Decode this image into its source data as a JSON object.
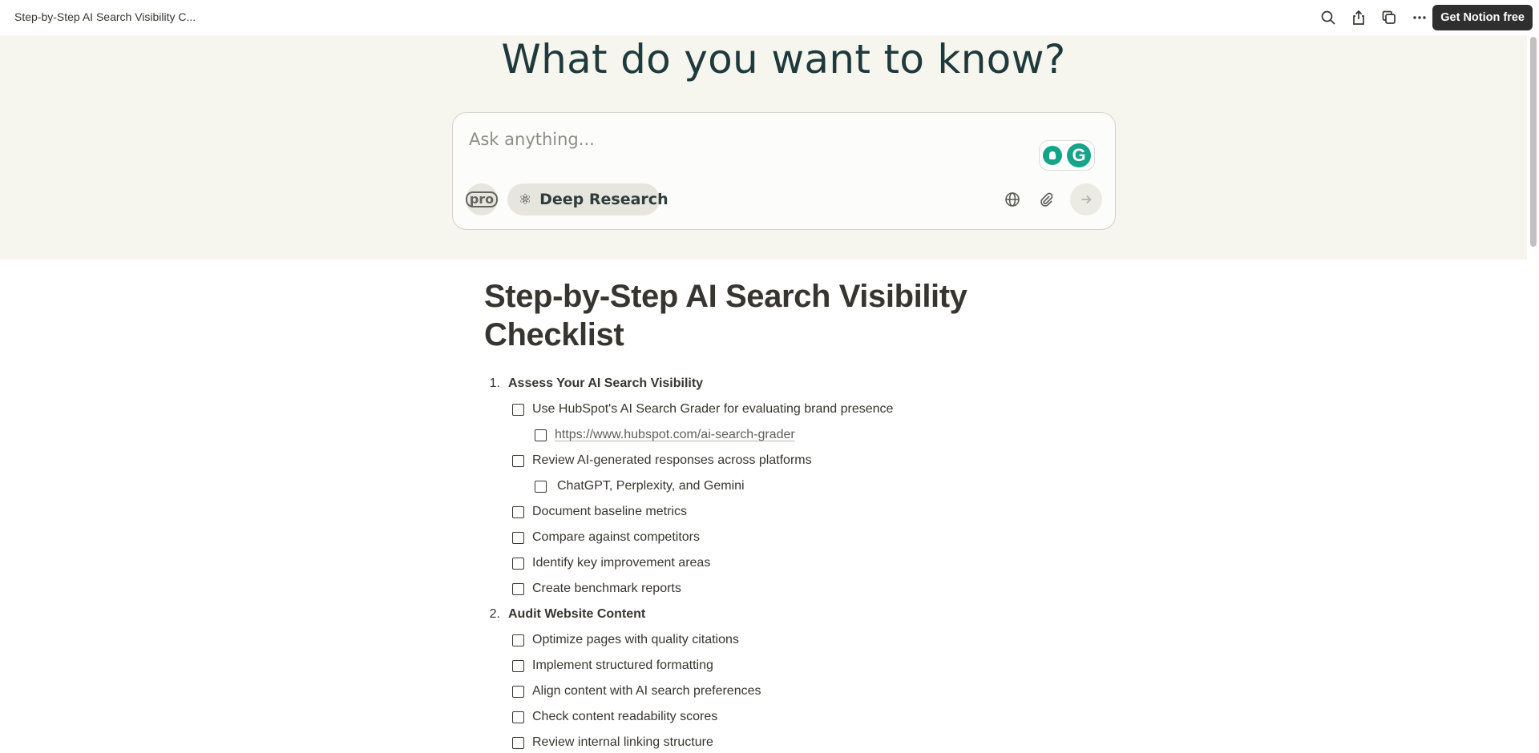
{
  "topbar": {
    "page_title": "Step-by-Step AI Search Visibility C...",
    "cta_label": "Get Notion free",
    "icons": [
      "search-icon",
      "share-icon",
      "duplicate-icon",
      "more-icon"
    ]
  },
  "search_embed": {
    "headline": "What do you want to know?",
    "placeholder": "Ask anything...",
    "pro_label": "pro",
    "deep_research_label": "Deep Research",
    "icons": [
      "grammarly-bulb-icon",
      "grammarly-logo-icon",
      "atom-icon",
      "globe-icon",
      "paperclip-icon",
      "arrow-right-icon"
    ]
  },
  "doc": {
    "title": "Step-by-Step AI Search Visibility Checklist",
    "sections": [
      {
        "number": "1.",
        "title": "Assess Your AI Search Visibility",
        "items": [
          {
            "text": "Use HubSpot's AI Search Grader for evaluating brand presence",
            "subitems": [
              {
                "text": "https://www.hubspot.com/ai-search-grader",
                "link": true
              }
            ]
          },
          {
            "text": "Review AI-generated responses across platforms",
            "subitems": [
              {
                "text": "ChatGPT, Perplexity, and Gemini"
              }
            ]
          },
          {
            "text": "Document baseline metrics"
          },
          {
            "text": "Compare against competitors"
          },
          {
            "text": "Identify key improvement areas"
          },
          {
            "text": "Create benchmark reports"
          }
        ]
      },
      {
        "number": "2.",
        "title": "Audit Website Content",
        "items": [
          {
            "text": "Optimize pages with quality citations"
          },
          {
            "text": "Implement structured formatting"
          },
          {
            "text": "Align content with AI search preferences"
          },
          {
            "text": "Check content readability scores"
          },
          {
            "text": "Review internal linking structure"
          }
        ]
      }
    ]
  }
}
